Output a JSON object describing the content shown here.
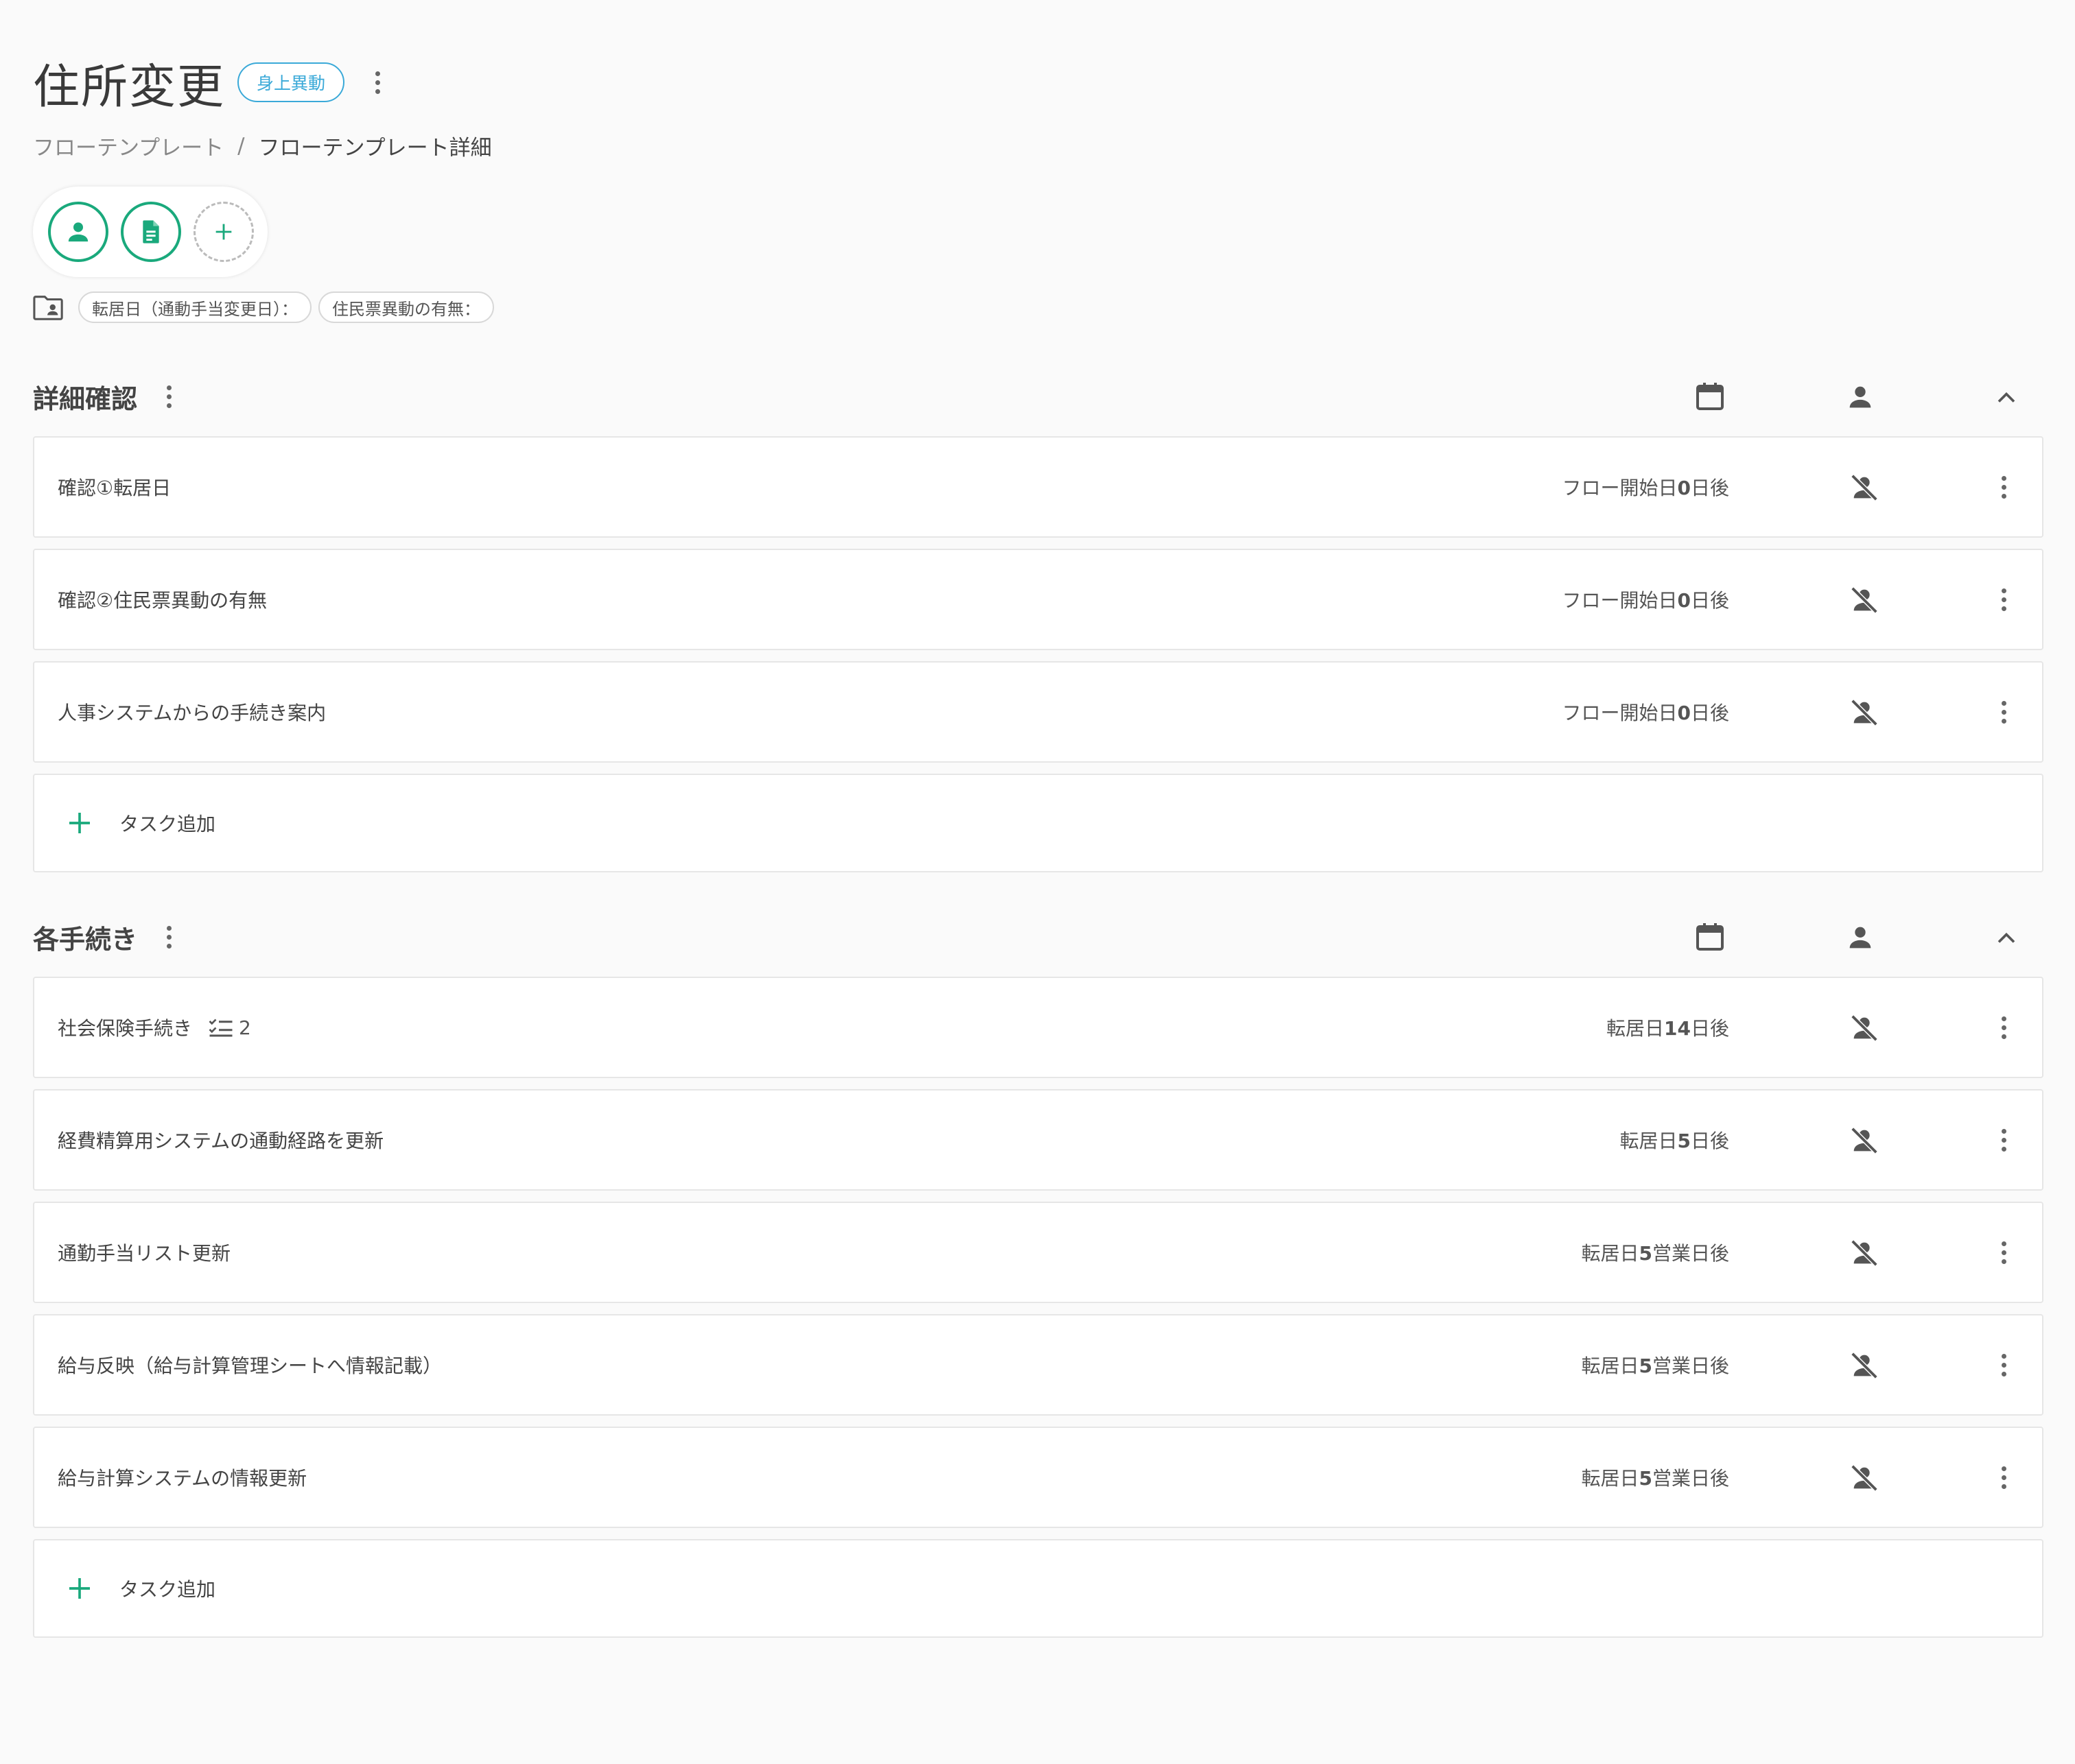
{
  "header": {
    "title": "住所変更",
    "category": "身上異動"
  },
  "breadcrumb": {
    "parent": "フローテンプレート",
    "separator": "/",
    "current": "フローテンプレート詳細"
  },
  "tags": [
    "転居日（通動手当変更日）：",
    "住民票異動の有無："
  ],
  "colors": {
    "accent": "#1aa97c",
    "chip": "#3aa9d8"
  },
  "sections": [
    {
      "title": "詳細確認",
      "add_label": "タスク追加",
      "tasks": [
        {
          "name": "確認①転居日",
          "due_pre": "フロー開始日",
          "due_num": "0",
          "due_post": "日後"
        },
        {
          "name": "確認②住民票異動の有無",
          "due_pre": "フロー開始日",
          "due_num": "0",
          "due_post": "日後"
        },
        {
          "name": "人事システムからの手続き案内",
          "due_pre": "フロー開始日",
          "due_num": "0",
          "due_post": "日後"
        }
      ]
    },
    {
      "title": "各手続き",
      "add_label": "タスク追加",
      "tasks": [
        {
          "name": "社会保険手続き",
          "subtasks": "2",
          "due_pre": "転居日",
          "due_num": "14",
          "due_post": "日後"
        },
        {
          "name": "経費精算用システムの通動経路を更新",
          "due_pre": "転居日",
          "due_num": "5",
          "due_post": "日後"
        },
        {
          "name": "通勤手当リスト更新",
          "due_pre": "転居日",
          "due_num": "5",
          "due_post": "営業日後"
        },
        {
          "name": "給与反映（給与計算管理シートへ情報記載）",
          "due_pre": "転居日",
          "due_num": "5",
          "due_post": "営業日後"
        },
        {
          "name": "給与計算システムの情報更新",
          "due_pre": "転居日",
          "due_num": "5",
          "due_post": "営業日後"
        }
      ]
    }
  ]
}
